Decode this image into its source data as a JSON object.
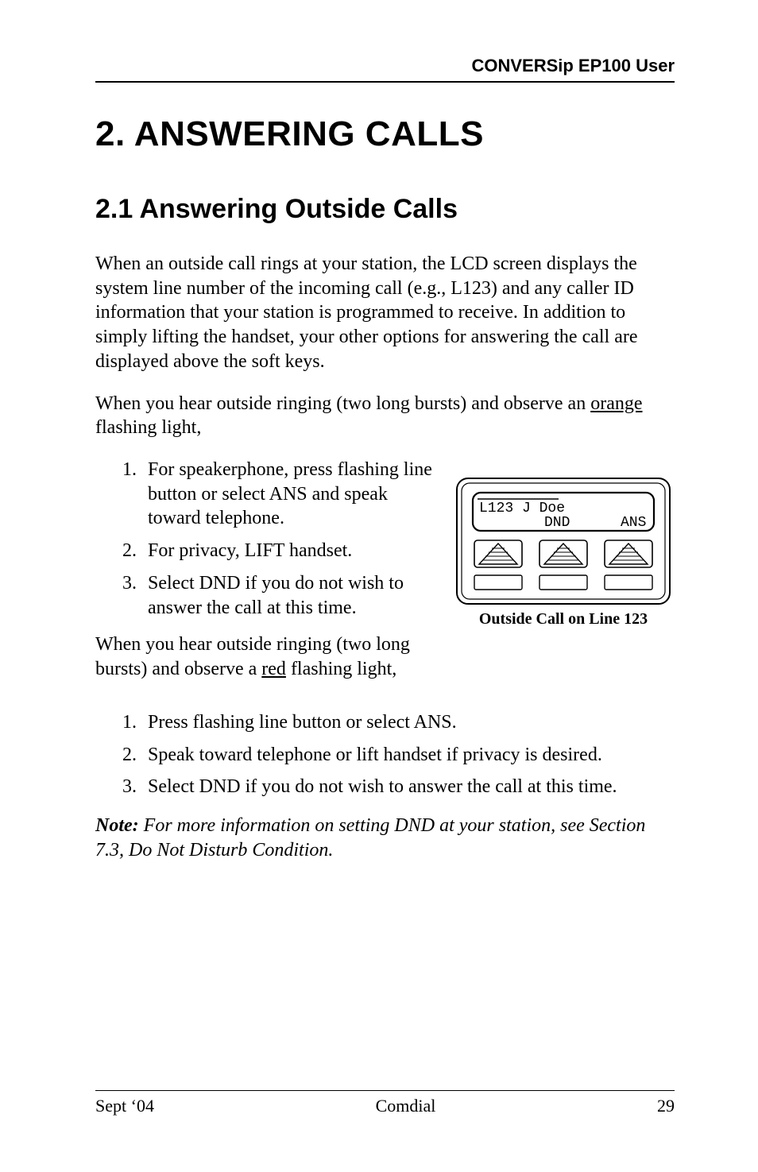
{
  "running_head": "CONVERSip EP100 User",
  "chapter_title": "2.  ANSWERING CALLS",
  "section_title": "2.1  Answering Outside Calls",
  "para1": "When an outside call rings at your station, the LCD screen displays the system line number of the incoming call (e.g., L123) and any caller ID information that your station is programmed to receive.  In addition to simply lifting the handset, your other options for answering the call are displayed above the soft keys.",
  "para2_pre": "When you hear outside ringing (two long bursts) and observe an ",
  "para2_u": "orange",
  "para2_post": " flashing light,",
  "listA": {
    "1": "For speakerphone, press flashing line button or select ANS and speak toward telephone.",
    "2": "For privacy, LIFT handset.",
    "3": "Select  DND if you do not wish to answer the call at this time."
  },
  "para3_pre": "When you hear outside ringing (two long bursts) and observe a ",
  "para3_u": "red",
  "para3_post": " flashing light,",
  "listB": {
    "1": "Press flashing line button or select ANS.",
    "2": "Speak toward telephone or lift handset if privacy is desired.",
    "3": "Select  DND if you do not wish to answer the call at this time."
  },
  "note_label": "Note:",
  "note_rest": "  For more information on setting DND at your station, see Section 7.3, Do Not Disturb Condition.",
  "lcd": {
    "line1": "L123 J Doe",
    "line2_left": "DND",
    "line2_right": "ANS",
    "caption": "Outside Call on Line 123"
  },
  "footer": {
    "left": "Sept ‘04",
    "center": "Comdial",
    "right": "29"
  }
}
